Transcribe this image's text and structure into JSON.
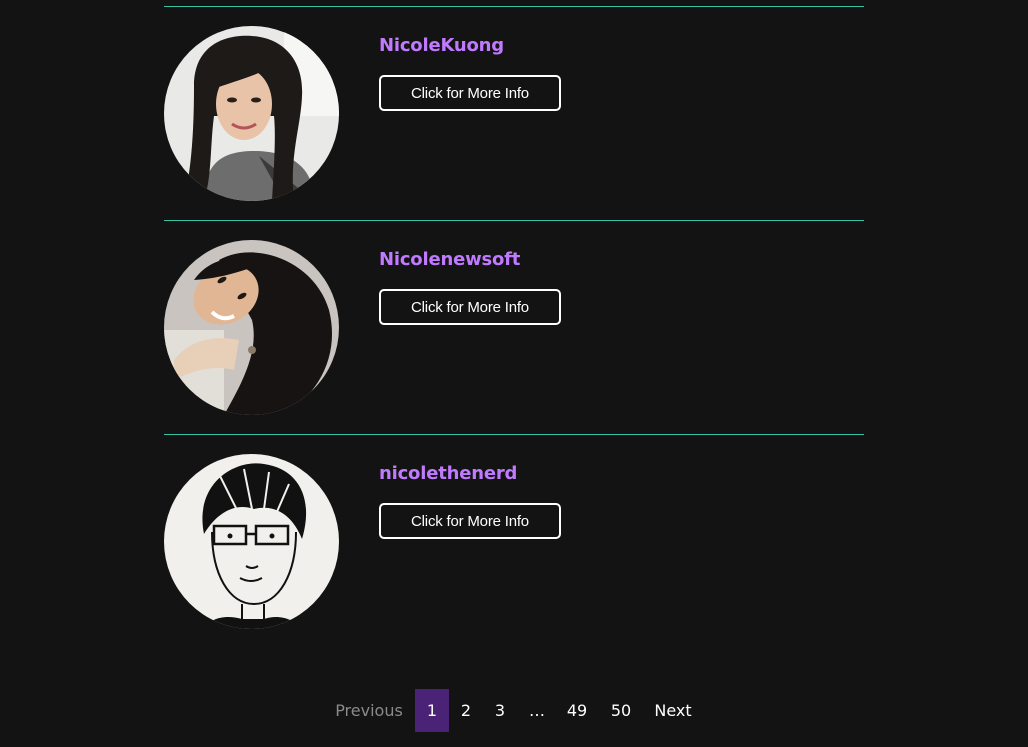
{
  "members": [
    {
      "username": "NicoleKuong",
      "button_label": "Click for More Info",
      "avatar_icon": "user-photo-icon"
    },
    {
      "username": "Nicolenewsoft",
      "button_label": "Click for More Info",
      "avatar_icon": "user-photo-icon"
    },
    {
      "username": "nicolethenerd",
      "button_label": "Click for More Info",
      "avatar_icon": "user-drawing-icon"
    }
  ],
  "pagination": {
    "previous_label": "Previous",
    "pages": [
      "1",
      "2",
      "3",
      "…",
      "49",
      "50"
    ],
    "current_page": "1",
    "next_label": "Next"
  },
  "colors": {
    "background": "#131313",
    "divider": "#37c2a6",
    "username": "#c07aff",
    "current_page_bg": "#4a2377"
  }
}
